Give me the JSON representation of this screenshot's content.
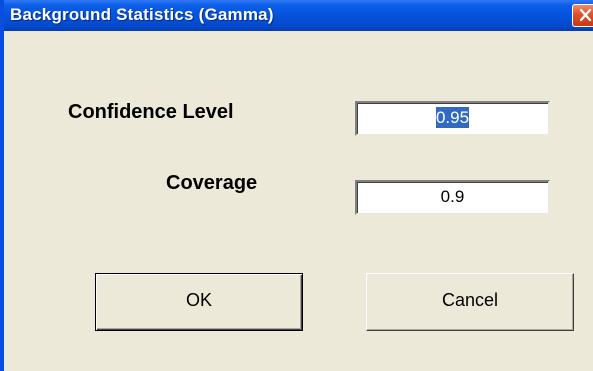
{
  "window": {
    "title": "Background Statistics (Gamma)",
    "close_icon": "close-x-icon"
  },
  "form": {
    "confidence_label": "Confidence Level",
    "confidence_value": "0.95",
    "coverage_label": "Coverage",
    "coverage_value": "0.9"
  },
  "buttons": {
    "ok_label": "OK",
    "cancel_label": "Cancel"
  },
  "colors": {
    "titlebar": "#0553dc",
    "dialog_bg": "#ece9d8",
    "selection": "#316ac5",
    "close_button": "#e0502a"
  }
}
